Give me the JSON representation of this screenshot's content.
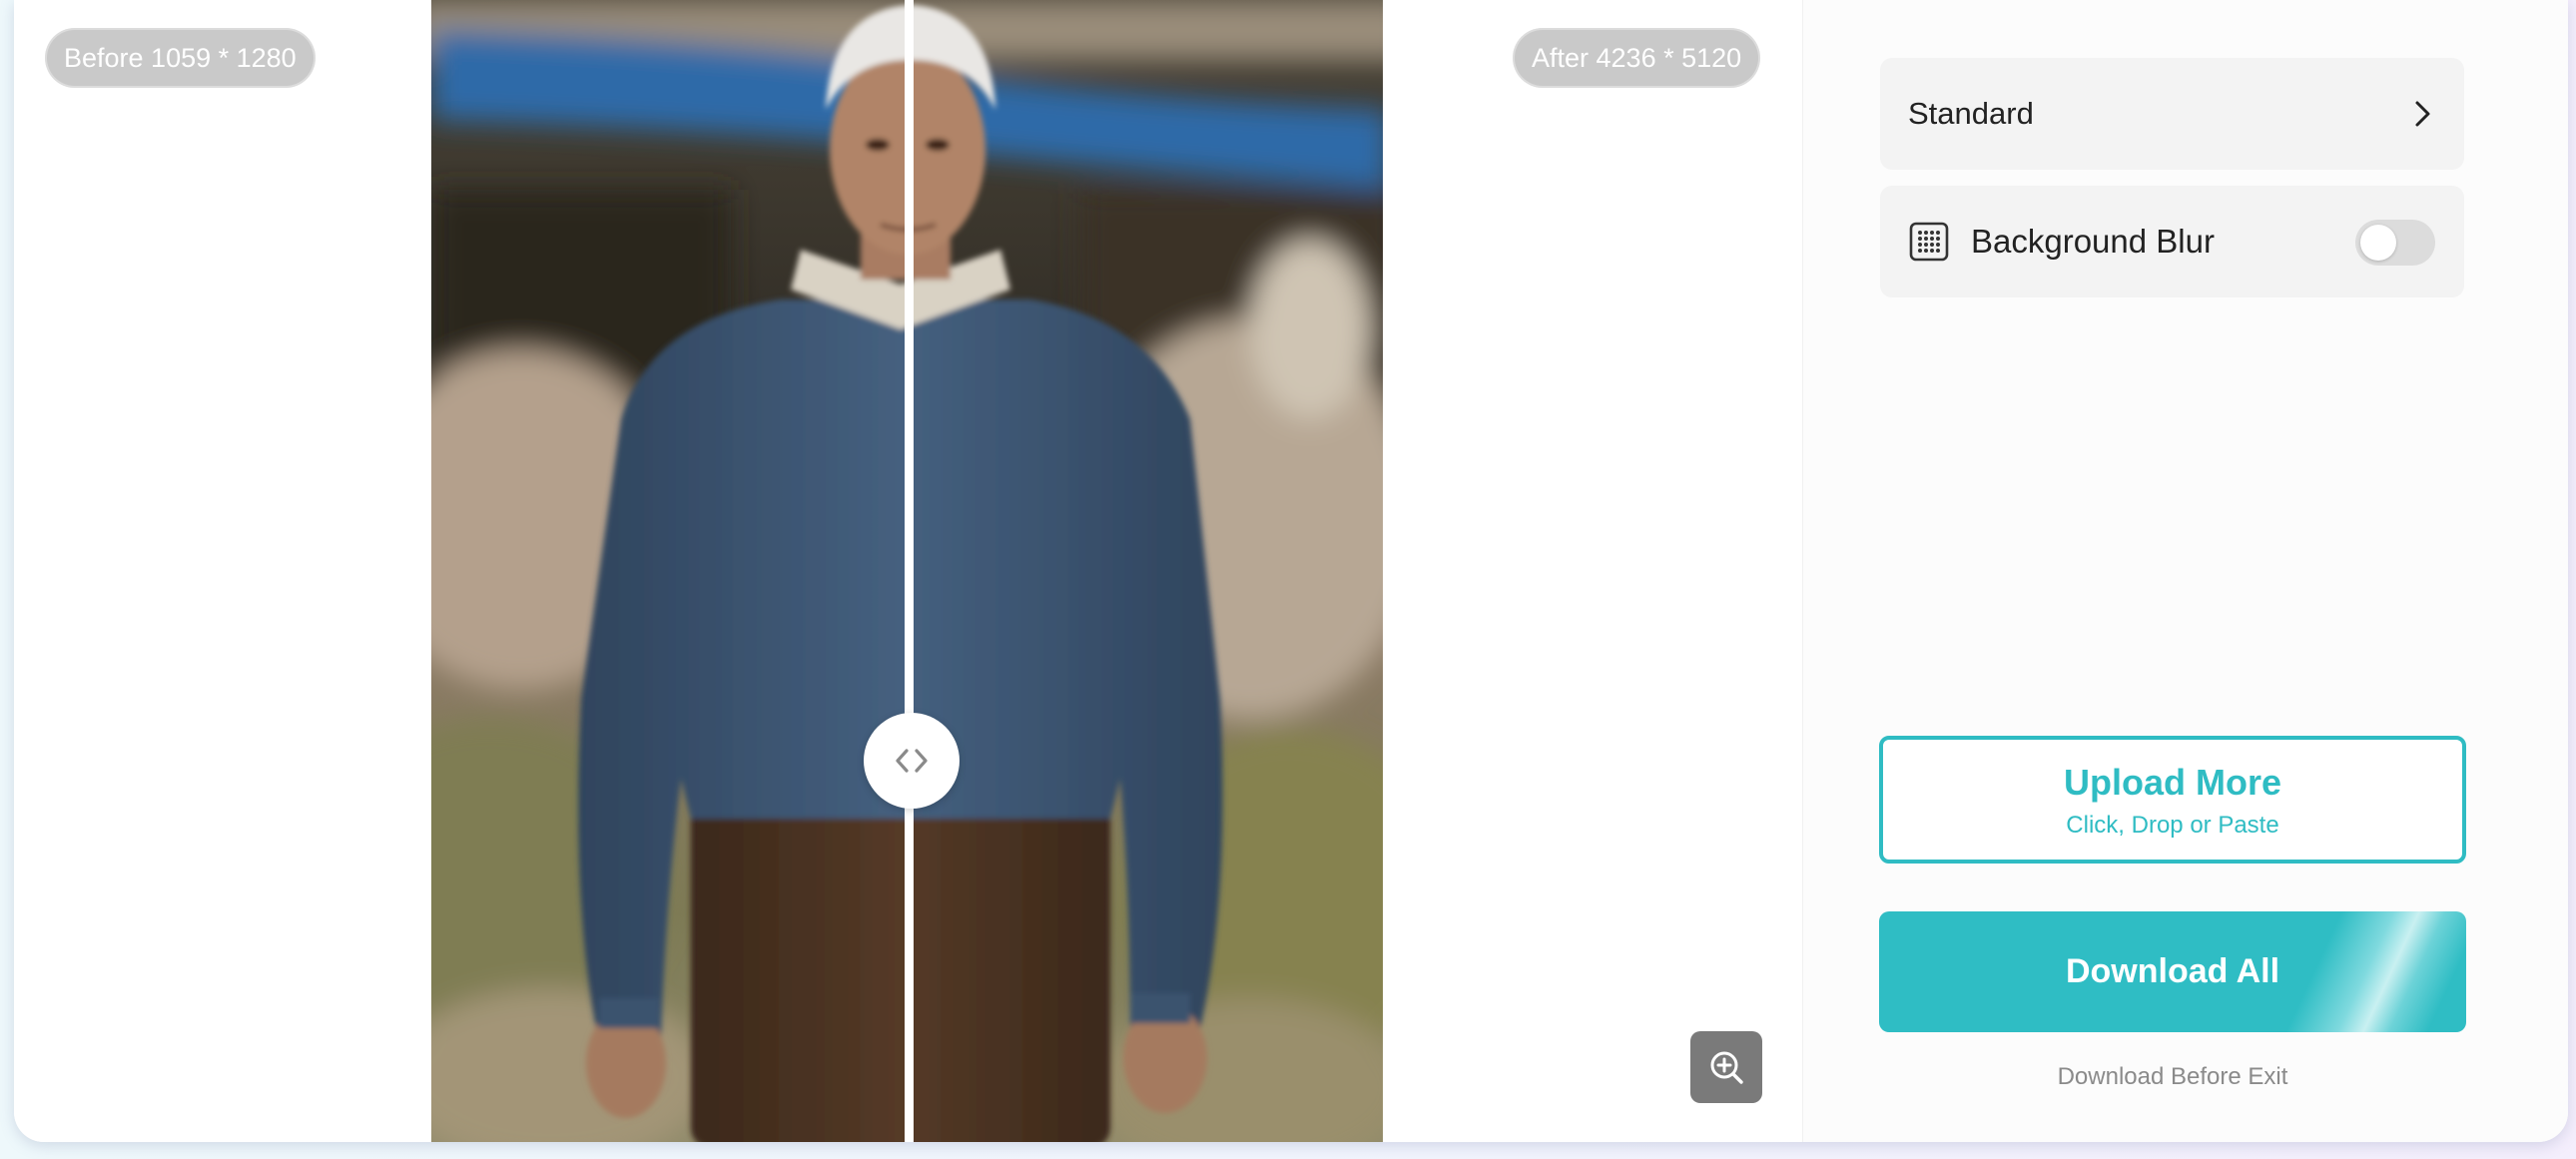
{
  "viewer": {
    "before_label": "Before 1059 * 1280",
    "after_label": "After 4236 * 5120",
    "photo_description_icon": "portrait-photo",
    "handle_icon": "code-arrows-icon",
    "zoom_icon": "zoom-in-icon"
  },
  "panel": {
    "mode_label": "Standard",
    "mode_icon": "chevron-right-icon",
    "blur_label": "Background Blur",
    "blur_icon": "dot-grid-icon",
    "blur_enabled": false,
    "upload_title": "Upload More",
    "upload_subtitle": "Click, Drop or Paste",
    "download_label": "Download All",
    "exit_label": "Download Before Exit"
  },
  "colors": {
    "accent": "#2fbcc3",
    "sweater": "#3e5774",
    "pants": "#4a3322",
    "badge": "#c9c9c9"
  }
}
